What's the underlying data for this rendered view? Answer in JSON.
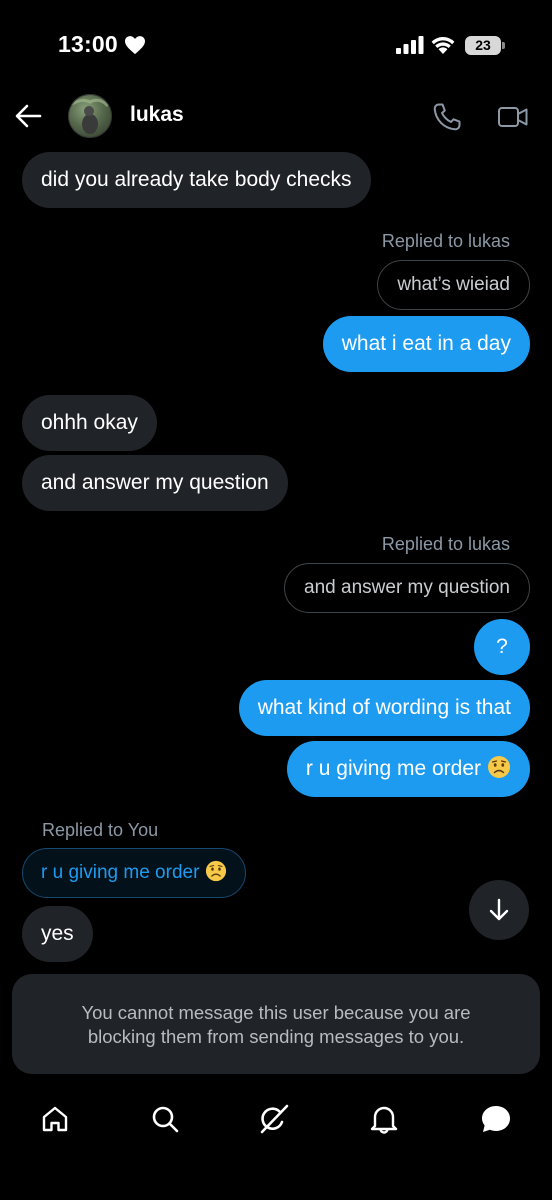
{
  "status_bar": {
    "time": "13:00",
    "battery": "23",
    "icons": [
      "heart-icon",
      "signal-icon",
      "wifi-icon",
      "battery-icon"
    ]
  },
  "header": {
    "name": "lukas",
    "icons": [
      "back-arrow-icon",
      "phone-icon",
      "video-call-icon"
    ]
  },
  "messages": [
    {
      "side": "in",
      "text": "did you already take body checks"
    },
    {
      "side": "out",
      "reply_label": "Replied to lukas",
      "quoted": "what’s wieiad",
      "text": "what i eat in a day"
    },
    {
      "side": "in",
      "text": "ohhh okay"
    },
    {
      "side": "in",
      "text": "and answer my question"
    },
    {
      "side": "out",
      "reply_label": "Replied to lukas",
      "quoted": "and answer my question",
      "text": "?"
    },
    {
      "side": "out",
      "text": "what kind of wording is that"
    },
    {
      "side": "out",
      "text": "r u giving me order",
      "emoji": "worried-face-emoji"
    },
    {
      "side": "in",
      "reply_label": "Replied to You",
      "quoted": "r u giving me order",
      "quoted_emoji": "worried-face-emoji",
      "text": "yes"
    }
  ],
  "composer": {
    "blocked_line1": "You cannot message this user because you are",
    "blocked_line2": "blocking them from sending messages to you."
  },
  "tab_bar": {
    "items": [
      "home-icon",
      "search-icon",
      "grok-icon",
      "notifications-icon",
      "messages-icon"
    ],
    "active": "messages-icon"
  },
  "colors": {
    "background": "#000000",
    "outgoing_bubble": "#1d9bf0",
    "incoming_bubble": "#202327",
    "muted_text": "#8b98a5"
  }
}
